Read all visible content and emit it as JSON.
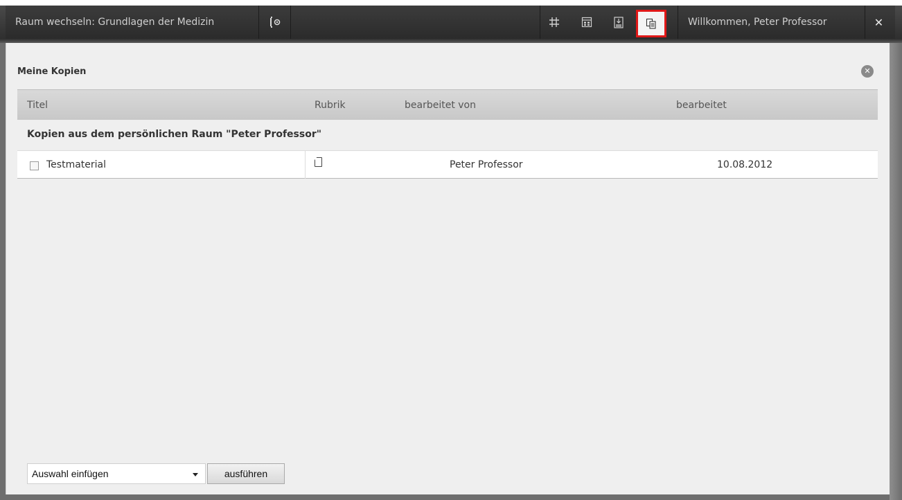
{
  "topbar": {
    "room_switch": "Raum wechseln: Grundlagen der Medizin",
    "config_icon": "key-gear-icon",
    "icons": [
      "grid-icon",
      "calendar-icon",
      "clipboard-icon",
      "copies-icon"
    ],
    "welcome": "Willkommen, Peter Professor",
    "close_icon": "close-icon"
  },
  "panel": {
    "title": "Meine Kopien",
    "close_icon": "circle-close-icon",
    "columns": {
      "titel": "Titel",
      "rubrik": "Rubrik",
      "bearbeitet_von": "bearbeitet von",
      "bearbeitet": "bearbeitet"
    },
    "group_header": "Kopien aus dem persönlichen Raum \"Peter Professor\"",
    "rows": [
      {
        "title": "Testmaterial",
        "rubrik_icon": "material-icon",
        "editor": "Peter Professor",
        "date": "10.08.2012"
      }
    ]
  },
  "footer": {
    "select_value": "Auswahl einfügen",
    "button_label": "ausführen"
  },
  "colors": {
    "topbar": "#2f2f2f",
    "highlight_border": "#e01818",
    "panel_bg": "#efefef"
  }
}
